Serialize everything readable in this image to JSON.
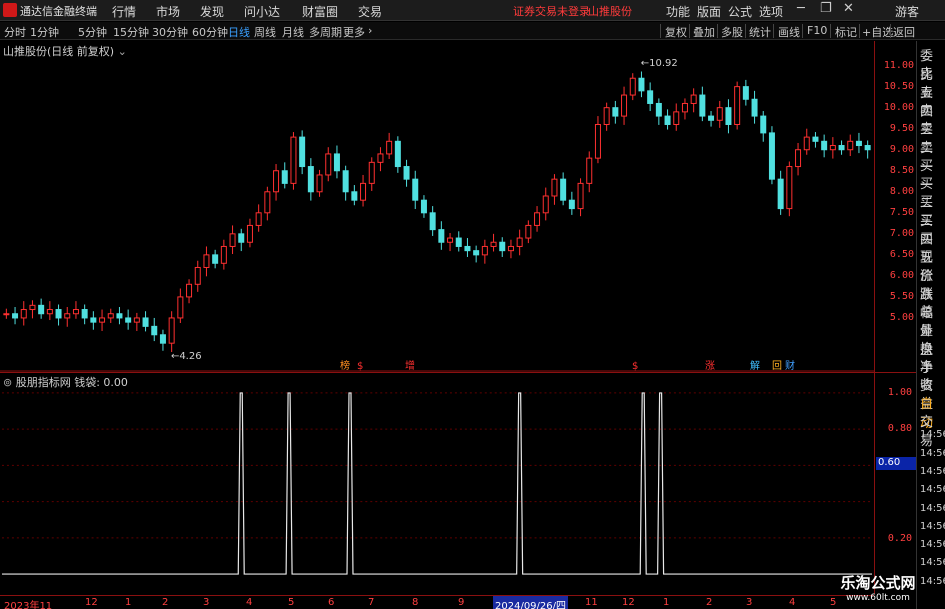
{
  "app": {
    "name": "通达信金融终端",
    "menu": [
      "行情",
      "市场",
      "发现",
      "问小达",
      "财富圈",
      "交易"
    ],
    "warning": "证券交易未登录",
    "stock_name_top": "山推股份",
    "right_menu": [
      "功能",
      "版面",
      "公式",
      "选项"
    ],
    "user": "游客"
  },
  "periods": [
    "分时",
    "1分钟",
    "5分钟",
    "15分钟",
    "30分钟",
    "60分钟",
    "日线",
    "周线",
    "月线",
    "多周期",
    "更多"
  ],
  "active_period": "日线",
  "toolbar": [
    "复权",
    "叠加",
    "多股",
    "统计",
    "画线",
    "F10",
    "标记",
    "+自选",
    "返回"
  ],
  "chart": {
    "title": "山推股份(日线 前复权)",
    "high_label": "10.92",
    "low_label": "4.26",
    "price_ticks": [
      "11.00",
      "10.50",
      "10.00",
      "9.50",
      "9.00",
      "8.50",
      "8.00",
      "7.50",
      "7.00",
      "6.50",
      "6.00",
      "5.50",
      "5.00"
    ],
    "badges": [
      "榜",
      "$",
      "增",
      "$",
      "涨",
      "解",
      "回",
      "财"
    ]
  },
  "indicator": {
    "title": "股朋指标网  钱袋: 0.00",
    "ticks": [
      "1.00",
      "0.80",
      "0.60",
      "0.20"
    ],
    "cursor_value": "0.60"
  },
  "right_panel": [
    "委比",
    "卖五",
    "卖四",
    "卖三",
    "卖二",
    "卖一",
    "买一",
    "买二",
    "买三",
    "买四",
    "买五",
    "现价",
    "涨跌",
    "涨幅",
    "总量",
    "外盘",
    "换手",
    "净资",
    "收益",
    "自动",
    "交易",
    "14:56",
    "14:56",
    "14:56",
    "14:56",
    "14:56",
    "14:56",
    "14:56",
    "14:56",
    "14:56"
  ],
  "time_axis": {
    "ticks": [
      "2023年11",
      "12",
      "1",
      "2",
      "3",
      "4",
      "5",
      "6",
      "7",
      "8",
      "9",
      "11",
      "12",
      "1",
      "2",
      "3",
      "4",
      "5"
    ],
    "highlight": "2024/09/26/四"
  },
  "watermark": {
    "line1": "乐淘公式网",
    "line2": "www.60lt.com"
  },
  "chart_data": {
    "type": "candlestick",
    "title": "山推股份(日线 前复权)",
    "ylim": [
      4.0,
      11.3
    ],
    "annotations": [
      {
        "label": "10.92",
        "value": 10.92
      },
      {
        "label": "4.26",
        "value": 4.26
      }
    ],
    "close_path": [
      5.1,
      5.0,
      5.2,
      5.3,
      5.1,
      5.2,
      5.0,
      5.1,
      5.2,
      5.0,
      4.9,
      5.0,
      5.1,
      5.0,
      4.9,
      5.0,
      4.8,
      4.6,
      4.4,
      5.0,
      5.5,
      5.8,
      6.2,
      6.5,
      6.3,
      6.7,
      7.0,
      6.8,
      7.2,
      7.5,
      8.0,
      8.5,
      8.2,
      9.3,
      8.6,
      8.0,
      8.4,
      8.9,
      8.5,
      8.0,
      7.8,
      8.2,
      8.7,
      8.9,
      9.2,
      8.6,
      8.3,
      7.8,
      7.5,
      7.1,
      6.8,
      6.9,
      6.7,
      6.6,
      6.5,
      6.7,
      6.8,
      6.6,
      6.7,
      6.9,
      7.2,
      7.5,
      7.9,
      8.3,
      7.8,
      7.6,
      8.2,
      8.8,
      9.6,
      10.0,
      9.8,
      10.3,
      10.7,
      10.4,
      10.1,
      9.8,
      9.6,
      9.9,
      10.1,
      10.3,
      9.8,
      9.7,
      10.0,
      9.6,
      10.5,
      10.2,
      9.8,
      9.4,
      8.3,
      7.6,
      8.6,
      9.0,
      9.3,
      9.2,
      9.0,
      9.1,
      9.0,
      9.2,
      9.1,
      9.0
    ],
    "signals_x_fraction": [
      0.275,
      0.33,
      0.4,
      0.595,
      0.737,
      0.757
    ]
  }
}
